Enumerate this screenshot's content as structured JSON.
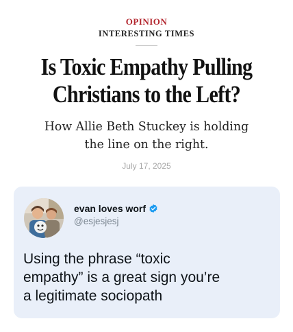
{
  "article": {
    "section": "OPINION",
    "column": "INTERESTING TIMES",
    "headline_lines": [
      "Is Toxic Empathy Pulling",
      "Christians to the Left?"
    ],
    "dek_lines": [
      "How Allie Beth Stuckey is holding",
      "the line on the right."
    ],
    "date": "July 17, 2025"
  },
  "tweet": {
    "display_name": "evan loves worf",
    "handle": "@esjesjesj",
    "verified_icon": "verified-badge-icon",
    "text_lines": [
      "Using the phrase “toxic",
      "empathy” is a great sign you’re",
      "a legitimate sociopath"
    ]
  },
  "colors": {
    "section_label": "#b3262e",
    "tweet_background": "#e9eff9",
    "verified": "#1d9bf0"
  }
}
